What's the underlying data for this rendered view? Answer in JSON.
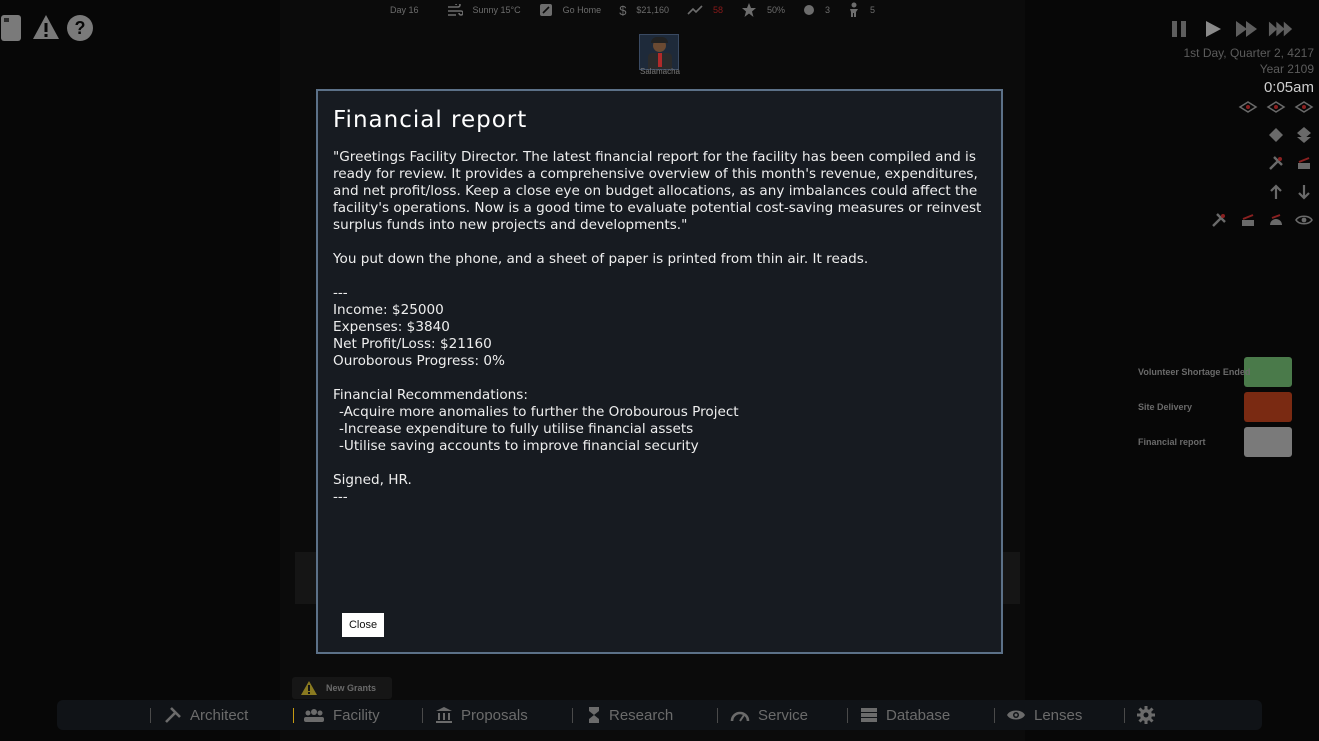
{
  "topbar": {
    "day": "Day 16",
    "weather": "Sunny 15°C",
    "task": "Go Home",
    "money": "$21,160",
    "trend_value": "58",
    "morale": "50%",
    "count_a": "3",
    "count_b": "5"
  },
  "staff": {
    "name": "Salamacha"
  },
  "clock": {
    "date_line": "1st Day, Quarter 2, 4217",
    "year_line": "Year 2109",
    "time": "0:05am"
  },
  "notifications": [
    {
      "label": "Volunteer Shortage Ended",
      "color": "#4a7a4a"
    },
    {
      "label": "Site Delivery",
      "color": "#7a2a12"
    },
    {
      "label": "Financial report",
      "color": "#7a7a7a"
    }
  ],
  "modal": {
    "title": "Financial report",
    "intro": "\"Greetings Facility Director. The latest financial report for the facility has been compiled and is ready for review. It provides a comprehensive overview of this month's revenue, expenditures, and net profit/loss. Keep a close eye on budget allocations, as any imbalances could affect the facility's operations. Now is a good time to evaluate potential cost-saving measures or reinvest surplus funds into new projects and developments.\"",
    "narration": "You put down the phone, and a sheet of paper is printed from thin air. It reads.",
    "divider": "---",
    "income": "Income: $25000",
    "expenses": "Expenses: $3840",
    "net": "Net Profit/Loss: $21160",
    "progress": "Ouroborous Progress: 0%",
    "rec_header": "Financial Recommendations:",
    "rec_1": "-Acquire more anomalies to further the Orobourous Project",
    "rec_2": "-Increase expenditure to fully utilise financial assets",
    "rec_3": "-Utilise saving accounts to improve financial security",
    "signed": "Signed, HR.",
    "close_label": "Close"
  },
  "grants": {
    "label": "New Grants"
  },
  "nav": {
    "architect": "Architect",
    "facility": "Facility",
    "proposals": "Proposals",
    "research": "Research",
    "service": "Service",
    "database": "Database",
    "lenses": "Lenses"
  }
}
